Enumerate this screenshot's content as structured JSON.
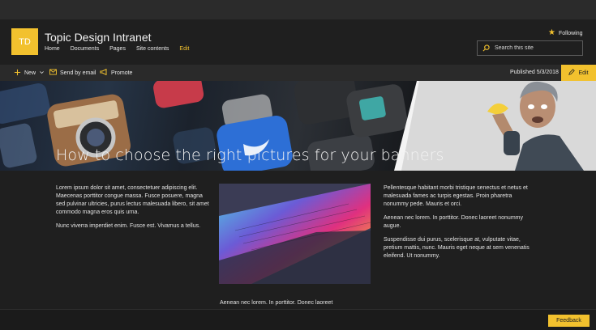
{
  "site": {
    "logo_text": "TD",
    "title": "Topic Design Intranet",
    "nav": [
      "Home",
      "Documents",
      "Pages",
      "Site contents",
      "Edit"
    ]
  },
  "header": {
    "following_label": "Following",
    "search_placeholder": "Search this site"
  },
  "commandbar": {
    "new_label": "New",
    "send_label": "Send by email",
    "promote_label": "Promote",
    "published_text": "Published 5/3/2018",
    "edit_label": "Edit"
  },
  "banner": {
    "title": "How to choose the right pictures for your banners"
  },
  "content": {
    "left": [
      "Lorem ipsum dolor sit amet, consectetuer adipiscing elit. Maecenas porttitor congue massa. Fusce posuere, magna sed pulvinar ultricies, purus lectus malesuada libero, sit amet commodo magna eros quis urna.",
      "Nunc viverra imperdiet enim. Fusce est. Vivamus a tellus."
    ],
    "right": [
      "Pellentesque habitant morbi tristique senectus et netus et malesuada fames ac turpis egestas. Proin pharetra nonummy pede. Mauris et orci.",
      "Aenean nec lorem. In porttitor. Donec laoreet nonummy augue.",
      "Suspendisse dui purus, scelerisque at, vulputate vitae, pretium mattis, nunc. Mauris eget neque at sem venenatis eleifend. Ut nonummy."
    ],
    "bottom_middle": "Aenean nec lorem. In porttitor. Donec laoreet"
  },
  "footer": {
    "feedback_label": "Feedback"
  },
  "colors": {
    "accent": "#f2c12e",
    "background": "#1f1f1f",
    "commandbar": "#2a2a2a"
  },
  "icons": {
    "star": "star-icon",
    "search": "search-icon",
    "new": "plus-icon",
    "send": "mail-icon",
    "promote": "megaphone-icon",
    "edit": "pencil-icon",
    "chevron": "chevron-down-icon"
  }
}
